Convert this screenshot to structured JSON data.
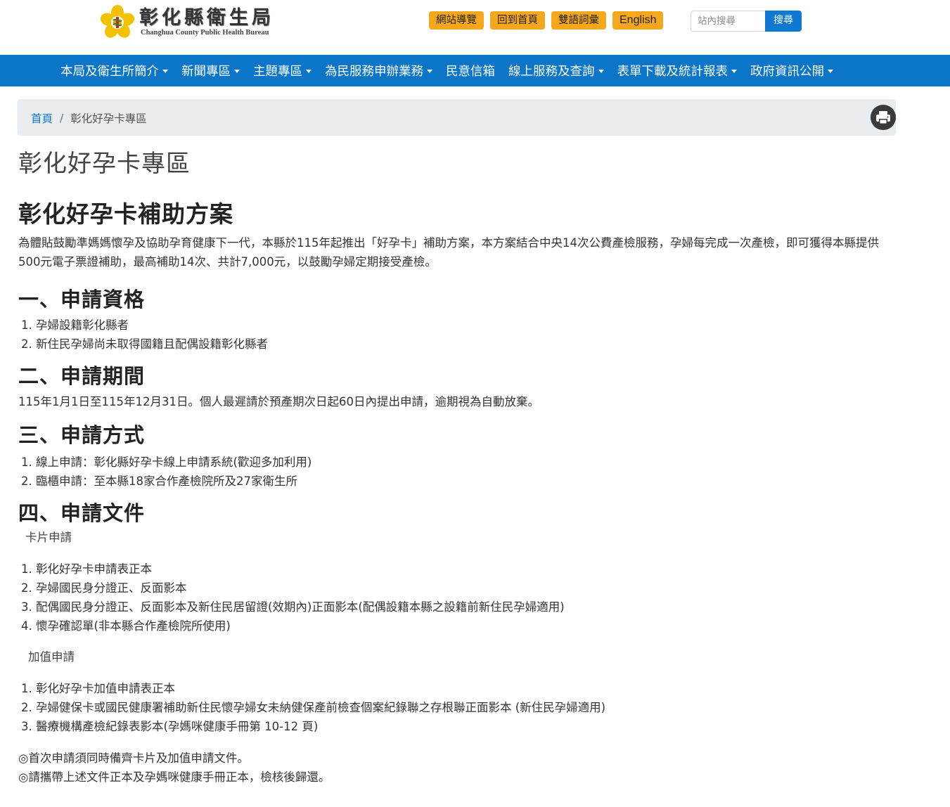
{
  "header": {
    "logo_title": "彰化縣衛生局",
    "logo_subtitle": "Changhua County Public Health Bureau",
    "top_links": [
      "網站導覽",
      "回到首頁",
      "雙語詞彙",
      "English"
    ],
    "search": {
      "placeholder": "站內搜尋",
      "button_label": "搜尋"
    },
    "colors": {
      "top_link_bg": "#f5a81c",
      "search_button_bg": "#0d79d1"
    }
  },
  "nav": {
    "bg_color": "#0b76c8",
    "items": [
      {
        "label": "本局及衛生所簡介",
        "dropdown": true
      },
      {
        "label": "新聞專區",
        "dropdown": true
      },
      {
        "label": "主題專區",
        "dropdown": true
      },
      {
        "label": "為民服務申辦業務",
        "dropdown": true
      },
      {
        "label": "民意信箱",
        "dropdown": false
      },
      {
        "label": "線上服務及查詢",
        "dropdown": true
      },
      {
        "label": "表單下載及統計報表",
        "dropdown": true
      },
      {
        "label": "政府資訊公開",
        "dropdown": true
      }
    ]
  },
  "breadcrumb": {
    "home": "首頁",
    "separator": "/",
    "current": "彰化好孕卡專區",
    "print_icon": "printer-icon"
  },
  "content": {
    "page_title": "彰化好孕卡專區",
    "article_title": "彰化好孕卡補助方案",
    "intro": "為體貼鼓勵準媽媽懷孕及協助孕育健康下一代，本縣於115年起推出「好孕卡」補助方案，本方案結合中央14次公費產檢服務，孕婦每完成一次產檢，即可獲得本縣提供500元電子票證補助，最高補助14次、共計7,000元，以鼓勵孕婦定期接受產檢。",
    "sections": {
      "eligibility": {
        "heading": "一、申請資格",
        "items": [
          "孕婦設籍彰化縣者",
          "新住民孕婦尚未取得國籍且配偶設籍彰化縣者"
        ]
      },
      "period": {
        "heading": "二、申請期間",
        "text": "115年1月1日至115年12月31日。個人最遲請於預產期次日起60日內提出申請，逾期視為自動放棄。"
      },
      "method": {
        "heading": "三、申請方式",
        "items": [
          "線上申請：彰化縣好孕卡線上申請系統(歡迎多加利用)",
          "臨櫃申請：至本縣18家合作產檢院所及27家衛生所"
        ]
      },
      "documents": {
        "heading": "四、申請文件",
        "card_label": "卡片申請",
        "card_items": [
          "彰化好孕卡申請表正本",
          "孕婦國民身分證正、反面影本",
          "配偶國民身分證正、反面影本及新住民居留證(效期內)正面影本(配偶設籍本縣之設籍前新住民孕婦適用)",
          "懷孕確認單(非本縣合作產檢院所使用)"
        ],
        "topup_label": "加值申請",
        "topup_items": [
          "彰化好孕卡加值申請表正本",
          "孕婦健保卡或國民健康署補助新住民懷孕婦女未納健保產前檢查個案紀錄聯之存根聯正面影本 (新住民孕婦適用)",
          "醫療機構產檢紀錄表影本(孕媽咪健康手冊第 10-12 頁)"
        ]
      }
    },
    "notes": [
      "◎首次申請須同時備齊卡片及加值申請文件。",
      "◎請攜帶上述文件正本及孕媽咪健康手冊正本，檢核後歸還。"
    ]
  }
}
